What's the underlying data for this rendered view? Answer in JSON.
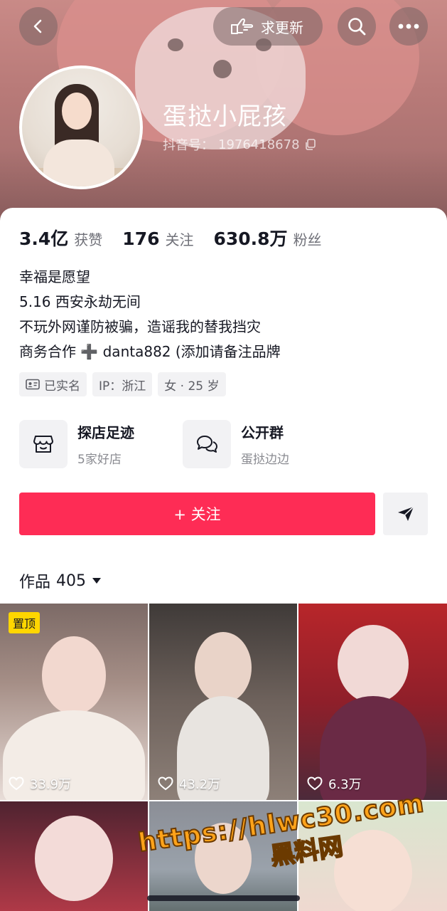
{
  "header": {
    "request_update_label": "求更新",
    "nickname": "蛋挞小屁孩",
    "douyin_id_label": "抖音号：",
    "douyin_id": "1976418678"
  },
  "stats": [
    {
      "value": "3.4亿",
      "label": "获赞"
    },
    {
      "value": "176",
      "label": "关注"
    },
    {
      "value": "630.8万",
      "label": "粉丝"
    }
  ],
  "bio": [
    "幸福是愿望",
    "5.16 西安永劫无间",
    "不玩外网谨防被骗，造谣我的替我挡灾",
    "商务合作 ➕ danta882 (添加请备注品牌"
  ],
  "tags": {
    "verified": "已实名",
    "ip": "IP：浙江",
    "gender_age": "女 · 25 岁"
  },
  "features": [
    {
      "title": "探店足迹",
      "subtitle": "5家好店",
      "icon": "store-icon"
    },
    {
      "title": "公开群",
      "subtitle": "蛋挞边边",
      "icon": "group-chat-icon"
    }
  ],
  "follow_label": "+ 关注",
  "works": {
    "label": "作品",
    "count": "405"
  },
  "videos": [
    {
      "likes": "33.9万",
      "pinned": true,
      "pin_label": "置顶"
    },
    {
      "likes": "43.2万",
      "pinned": false
    },
    {
      "likes": "6.3万",
      "pinned": false
    },
    {
      "likes": "",
      "pinned": false
    },
    {
      "likes": "",
      "pinned": false
    },
    {
      "likes": "",
      "pinned": false
    }
  ],
  "watermark": {
    "line1": "https://hlwc30.com",
    "line2": "黑料网"
  },
  "colors": {
    "follow": "#fe2c55",
    "pin_badge": "#ffd600",
    "watermark": "#ffa31a"
  }
}
